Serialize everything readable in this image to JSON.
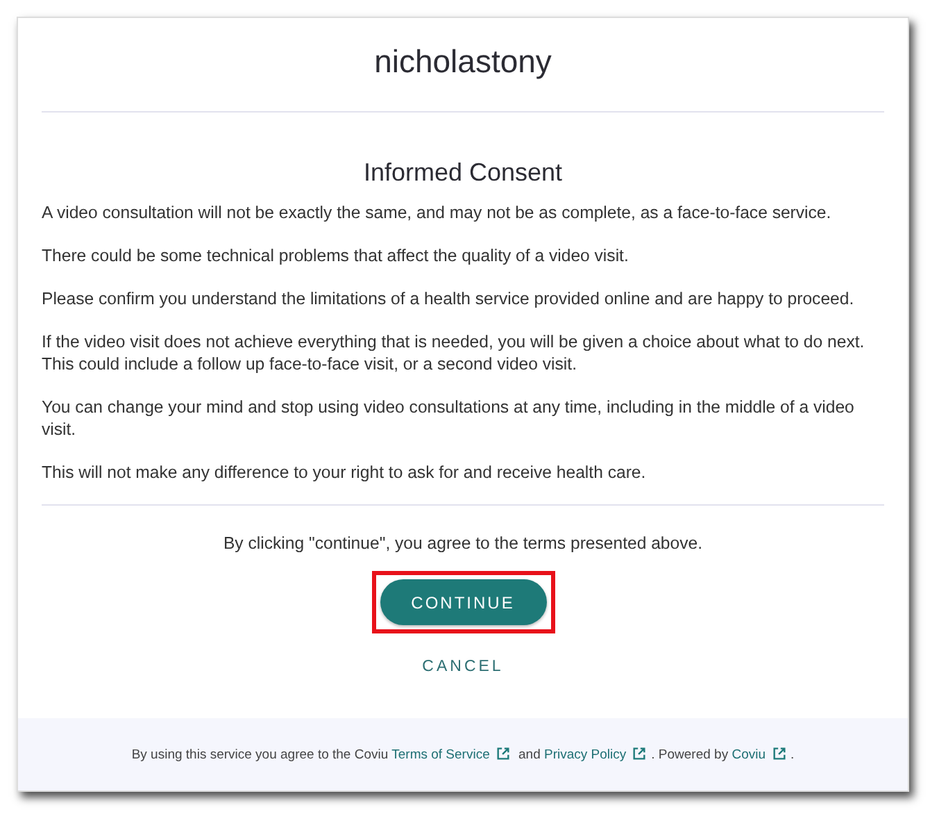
{
  "header": {
    "title": "nicholastony"
  },
  "consent": {
    "heading": "Informed Consent",
    "paragraphs": [
      "A video consultation will not be exactly the same, and may not be as complete, as a face-to-face service.",
      "There could be some technical problems that affect the quality of a video visit.",
      "Please confirm you understand the limitations of a health service provided online and are happy to proceed.",
      "If the video visit does not achieve everything that is needed, you will be given a choice about what to do next. This could include a follow up face-to-face visit, or a second video visit.",
      "You can change your mind and stop using video consultations at any time, including in the middle of a video visit.",
      "This will not make any difference to your right to ask for and receive health care."
    ]
  },
  "agreement": "By clicking \"continue\", you agree to the terms presented above.",
  "continue_button": {
    "label": "CONTINUE",
    "highlighted": true
  },
  "cancel_link": "CANCEL",
  "footer": [
    {
      "kind": "text",
      "text": "By using this service you agree to the Coviu "
    },
    {
      "kind": "link",
      "text": "Terms of Service"
    },
    {
      "kind": "text",
      "text": " and "
    },
    {
      "kind": "link",
      "text": "Privacy Policy"
    },
    {
      "kind": "text",
      "text": ". Powered by "
    },
    {
      "kind": "link",
      "text": "Coviu"
    },
    {
      "kind": "text",
      "text": "."
    }
  ]
}
